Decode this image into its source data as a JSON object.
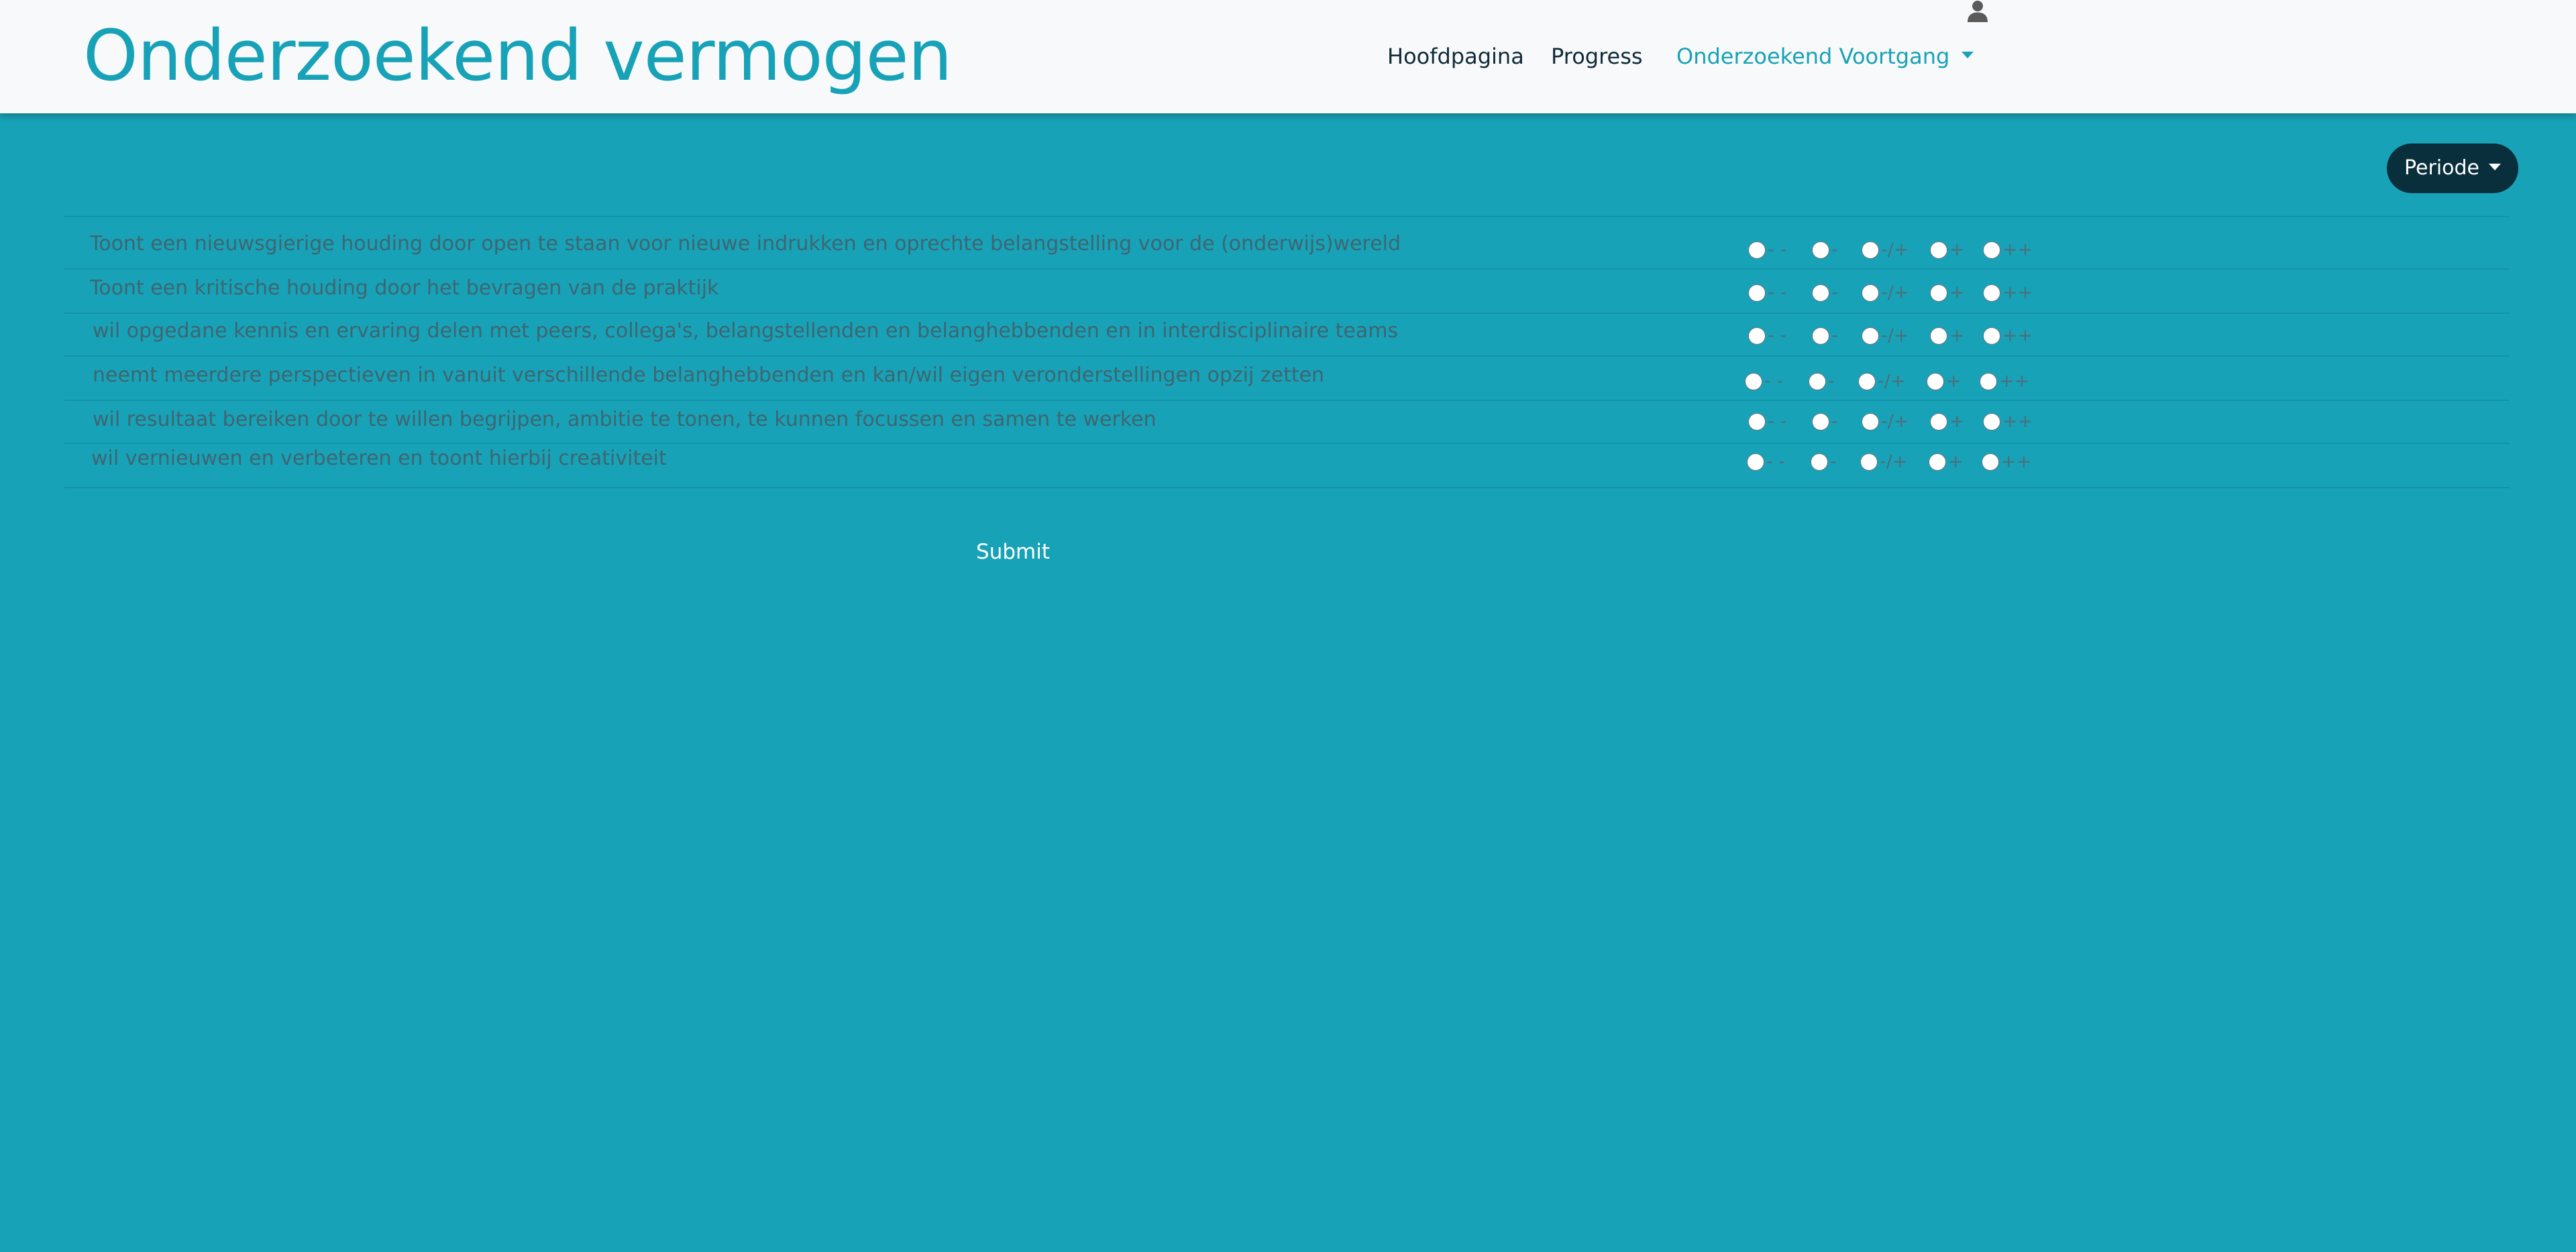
{
  "header": {
    "brand": "Onderzoekend vermogen",
    "nav": {
      "home": "Hoofdpagina",
      "progress": "Progress",
      "dropdown": "Onderzoekend Voortgang"
    },
    "user_icon": "user-icon"
  },
  "periode_button": "Periode",
  "scale_options": [
    "- -",
    "-",
    "-/+",
    "+",
    "++"
  ],
  "questions": [
    "Toont een nieuwsgierige houding door open te staan voor nieuwe indrukken en oprechte belangstelling voor de (onderwijs)wereld",
    "Toont een kritische houding door het bevragen van de praktijk",
    "wil opgedane kennis en ervaring delen met peers, collega's, belangstellenden en belanghebbenden en in interdisciplinaire teams",
    "neemt meerdere perspectieven in vanuit verschillende belanghebbenden en kan/wil eigen veronderstellingen opzij zetten",
    "wil resultaat bereiken door te willen begrijpen, ambitie te tonen, te kunnen focussen en samen te werken",
    "wil vernieuwen en verbeteren en toont hierbij creativiteit"
  ],
  "submit_button": "Submit",
  "colors": {
    "page_background": "#17a2b8",
    "navbar_background": "#f8f9fa",
    "brand": "#17a2b8",
    "periode_button": "#0a2f3c"
  }
}
